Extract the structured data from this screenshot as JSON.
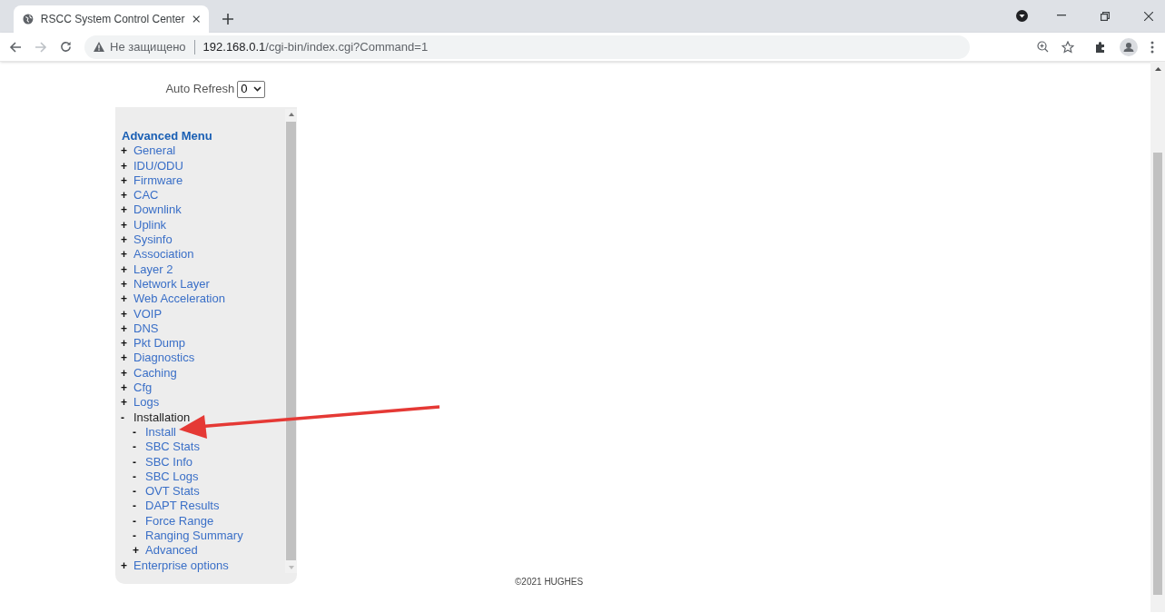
{
  "browser": {
    "tab_title": "RSCC System Control Center",
    "security_label": "Не защищено",
    "url_host": "192.168.0.1",
    "url_path": "/cgi-bin/index.cgi?Command=1"
  },
  "auto_refresh": {
    "label": "Auto Refresh",
    "value": "0"
  },
  "menu": {
    "title": "Advanced Menu",
    "items": [
      {
        "marker": "+",
        "label": "General",
        "expanded": false
      },
      {
        "marker": "+",
        "label": "IDU/ODU",
        "expanded": false
      },
      {
        "marker": "+",
        "label": "Firmware",
        "expanded": false
      },
      {
        "marker": "+",
        "label": "CAC",
        "expanded": false
      },
      {
        "marker": "+",
        "label": "Downlink",
        "expanded": false
      },
      {
        "marker": "+",
        "label": "Uplink",
        "expanded": false
      },
      {
        "marker": "+",
        "label": "Sysinfo",
        "expanded": false
      },
      {
        "marker": "+",
        "label": "Association",
        "expanded": false
      },
      {
        "marker": "+",
        "label": "Layer 2",
        "expanded": false
      },
      {
        "marker": "+",
        "label": "Network Layer",
        "expanded": false
      },
      {
        "marker": "+",
        "label": "Web Acceleration",
        "expanded": false
      },
      {
        "marker": "+",
        "label": "VOIP",
        "expanded": false
      },
      {
        "marker": "+",
        "label": "DNS",
        "expanded": false
      },
      {
        "marker": "+",
        "label": "Pkt Dump",
        "expanded": false
      },
      {
        "marker": "+",
        "label": "Diagnostics",
        "expanded": false
      },
      {
        "marker": "+",
        "label": "Caching",
        "expanded": false
      },
      {
        "marker": "+",
        "label": "Cfg",
        "expanded": false
      },
      {
        "marker": "+",
        "label": "Logs",
        "expanded": false
      },
      {
        "marker": "-",
        "label": "Installation",
        "expanded": true,
        "children": [
          {
            "marker": "-",
            "label": "Install"
          },
          {
            "marker": "-",
            "label": "SBC Stats"
          },
          {
            "marker": "-",
            "label": "SBC Info"
          },
          {
            "marker": "-",
            "label": "SBC Logs"
          },
          {
            "marker": "-",
            "label": "OVT Stats"
          },
          {
            "marker": "-",
            "label": "DAPT Results"
          },
          {
            "marker": "-",
            "label": "Force Range"
          },
          {
            "marker": "-",
            "label": "Ranging Summary"
          },
          {
            "marker": "+",
            "label": "Advanced",
            "expanded": false
          }
        ]
      },
      {
        "marker": "+",
        "label": "Enterprise options",
        "expanded": false
      }
    ]
  },
  "footer": "©2021 HUGHES"
}
